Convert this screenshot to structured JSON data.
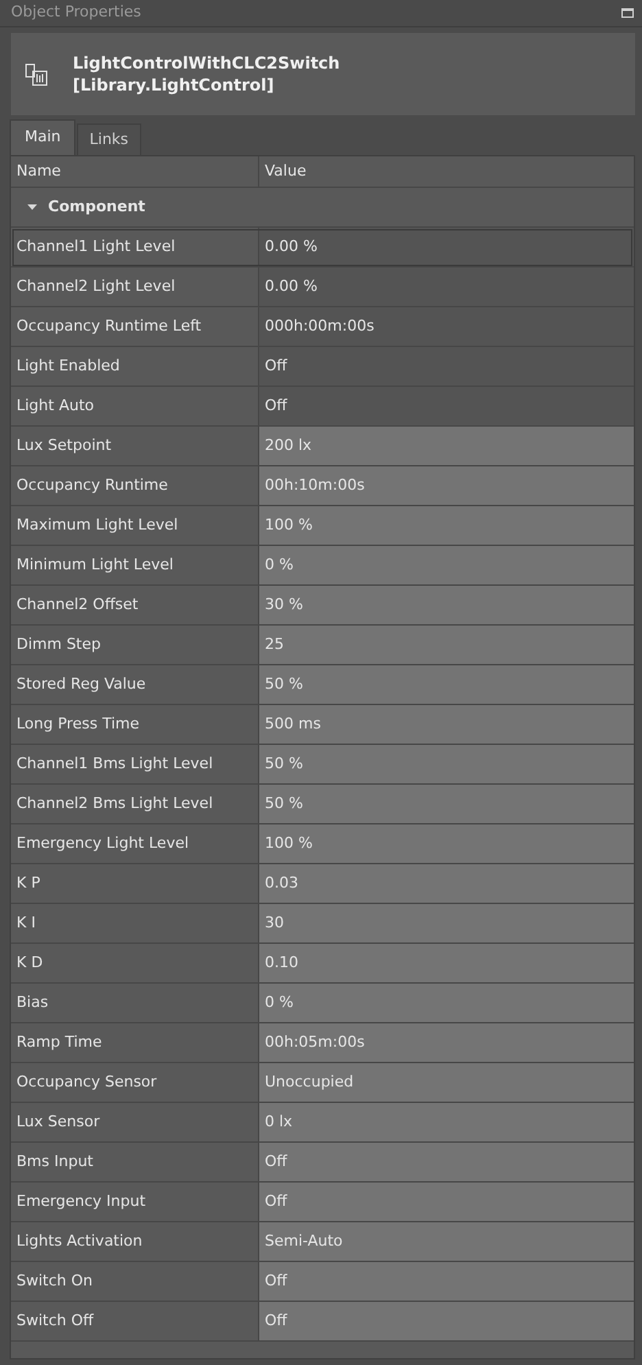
{
  "panel": {
    "title": "Object Properties"
  },
  "object": {
    "name": "LightControlWithCLC2Switch",
    "type": "[Library.LightControl]"
  },
  "tabs": [
    {
      "label": "Main",
      "selected": true
    },
    {
      "label": "Links",
      "selected": false
    }
  ],
  "table": {
    "columns": [
      "Name",
      "Value"
    ],
    "group": {
      "label": "Component",
      "expanded": true
    },
    "rows": [
      {
        "name": "Channel1 Light Level",
        "value": "0.00 %",
        "editable": false,
        "selected": true
      },
      {
        "name": "Channel2 Light Level",
        "value": "0.00 %",
        "editable": false,
        "selected": false
      },
      {
        "name": "Occupancy Runtime Left",
        "value": "000h:00m:00s",
        "editable": false,
        "selected": false
      },
      {
        "name": "Light Enabled",
        "value": "Off",
        "editable": false,
        "selected": false
      },
      {
        "name": "Light Auto",
        "value": "Off",
        "editable": false,
        "selected": false
      },
      {
        "name": "Lux Setpoint",
        "value": "200 lx",
        "editable": true,
        "selected": false
      },
      {
        "name": "Occupancy Runtime",
        "value": "00h:10m:00s",
        "editable": true,
        "selected": false
      },
      {
        "name": "Maximum Light Level",
        "value": "100 %",
        "editable": true,
        "selected": false
      },
      {
        "name": "Minimum Light Level",
        "value": "0 %",
        "editable": true,
        "selected": false
      },
      {
        "name": "Channel2 Offset",
        "value": "30 %",
        "editable": true,
        "selected": false
      },
      {
        "name": "Dimm Step",
        "value": "25",
        "editable": true,
        "selected": false
      },
      {
        "name": "Stored Reg Value",
        "value": "50 %",
        "editable": true,
        "selected": false
      },
      {
        "name": "Long Press Time",
        "value": "500 ms",
        "editable": true,
        "selected": false
      },
      {
        "name": "Channel1 Bms Light Level",
        "value": "50 %",
        "editable": true,
        "selected": false
      },
      {
        "name": "Channel2 Bms Light Level",
        "value": "50 %",
        "editable": true,
        "selected": false
      },
      {
        "name": "Emergency Light Level",
        "value": "100 %",
        "editable": true,
        "selected": false
      },
      {
        "name": "K P",
        "value": "0.03",
        "editable": true,
        "selected": false
      },
      {
        "name": "K I",
        "value": "30",
        "editable": true,
        "selected": false
      },
      {
        "name": "K D",
        "value": "0.10",
        "editable": true,
        "selected": false
      },
      {
        "name": "Bias",
        "value": "0 %",
        "editable": true,
        "selected": false
      },
      {
        "name": "Ramp Time",
        "value": "00h:05m:00s",
        "editable": true,
        "selected": false
      },
      {
        "name": "Occupancy Sensor",
        "value": "Unoccupied",
        "editable": true,
        "selected": false
      },
      {
        "name": "Lux Sensor",
        "value": "0 lx",
        "editable": true,
        "selected": false
      },
      {
        "name": "Bms Input",
        "value": "Off",
        "editable": true,
        "selected": false
      },
      {
        "name": "Emergency Input",
        "value": "Off",
        "editable": true,
        "selected": false
      },
      {
        "name": "Lights Activation",
        "value": "Semi-Auto",
        "editable": true,
        "selected": false
      },
      {
        "name": "Switch On",
        "value": "Off",
        "editable": true,
        "selected": false
      },
      {
        "name": "Switch Off",
        "value": "Off",
        "editable": true,
        "selected": false
      }
    ]
  }
}
